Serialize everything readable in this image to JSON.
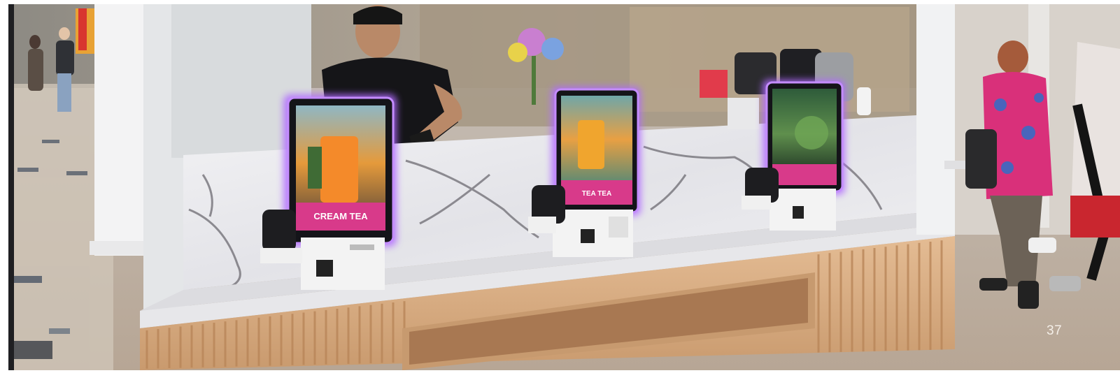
{
  "page": {
    "page_number": "37"
  },
  "scene": {
    "description_kind": "photo",
    "kiosks": [
      {
        "screen_label": "CREAM TEA"
      },
      {
        "screen_label": "TEA TEA"
      },
      {
        "screen_label": ""
      }
    ],
    "colors": {
      "screen_glow": "#b068ff",
      "screen_banner": "#d83a8a",
      "marble": "#e9e9ec",
      "wood_slats": "#d9ae85",
      "floor": "#c9b9a6"
    }
  }
}
